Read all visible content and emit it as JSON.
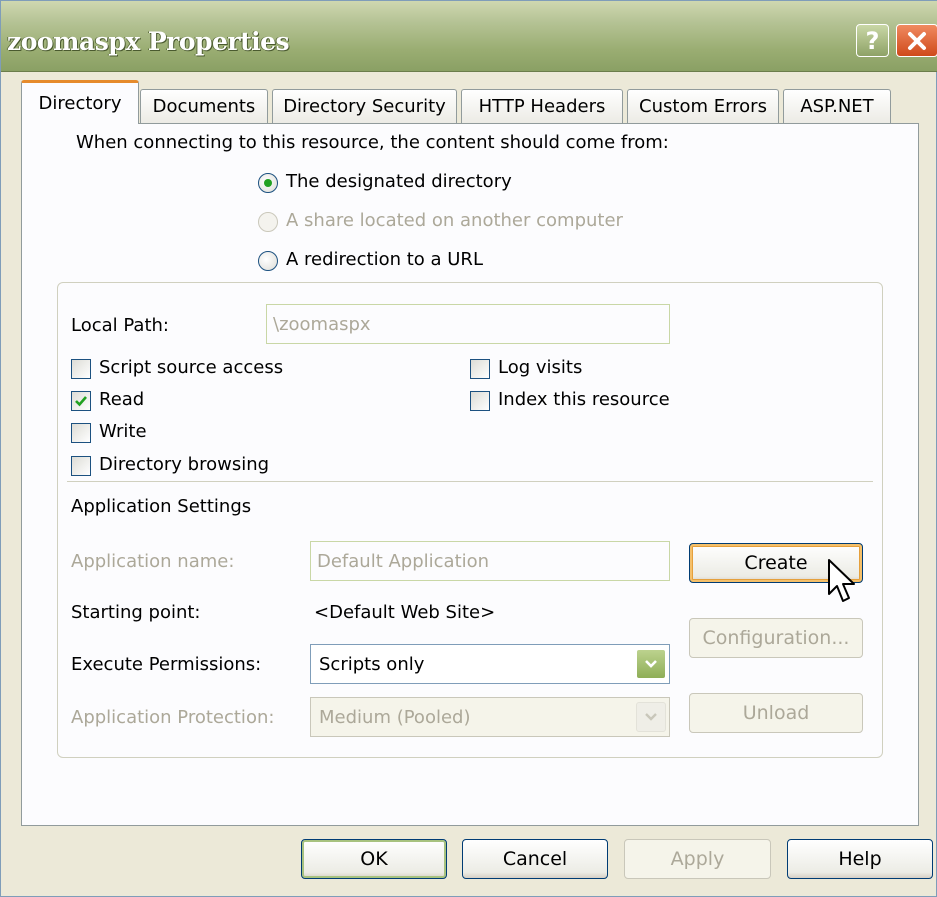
{
  "window": {
    "title": "zoomaspx Properties",
    "help_glyph": "?",
    "close_icon": "close-icon"
  },
  "tabs": [
    {
      "label": "Directory",
      "active": true
    },
    {
      "label": "Documents"
    },
    {
      "label": "Directory Security"
    },
    {
      "label": "HTTP Headers"
    },
    {
      "label": "Custom Errors"
    },
    {
      "label": "ASP.NET"
    }
  ],
  "content_source": {
    "prompt": "When connecting to this resource, the content should come from:",
    "options": [
      {
        "label": "The designated directory",
        "checked": true,
        "enabled": true
      },
      {
        "label": "A share located on another computer",
        "checked": false,
        "enabled": false
      },
      {
        "label": "A redirection to a URL",
        "checked": false,
        "enabled": true
      }
    ]
  },
  "local_path": {
    "label": "Local Path:",
    "value": "\\zoomaspx"
  },
  "access": {
    "script_source": {
      "label": "Script source access",
      "checked": false
    },
    "read": {
      "label": "Read",
      "checked": true
    },
    "write": {
      "label": "Write",
      "checked": false
    },
    "directory_browsing": {
      "label": "Directory browsing",
      "checked": false
    },
    "log_visits": {
      "label": "Log visits",
      "checked": false
    },
    "index_resource": {
      "label": "Index this resource",
      "checked": false
    }
  },
  "app_settings": {
    "heading": "Application Settings",
    "app_name_label": "Application name:",
    "app_name_value": "Default Application",
    "starting_point_label": "Starting point:",
    "starting_point_value": "<Default Web Site>",
    "execute_label": "Execute Permissions:",
    "execute_value": "Scripts only",
    "protection_label": "Application Protection:",
    "protection_value": "Medium (Pooled)",
    "create_button": "Create",
    "configuration_button": "Configuration...",
    "unload_button": "Unload"
  },
  "footer": {
    "ok": "OK",
    "cancel": "Cancel",
    "apply": "Apply",
    "help": "Help"
  },
  "colors": {
    "title_bar": "#9aad72",
    "active_tab_accent": "#e68b2c",
    "check": "#21a121",
    "face": "#ece9d8"
  }
}
